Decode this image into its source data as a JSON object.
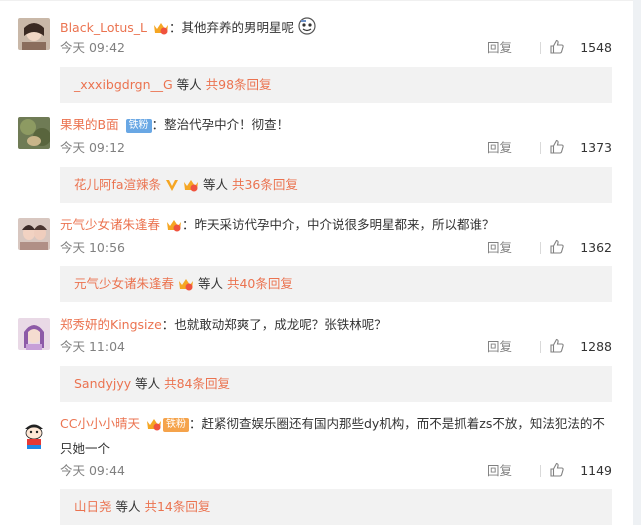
{
  "comments": [
    {
      "username": "Black_Lotus_L",
      "colon": "：",
      "text": "其他弃养的男明星呢",
      "time": "今天 09:42",
      "reply_label": "回复",
      "likes": "1548",
      "replies": {
        "names": "_xxxibgdrgn__G",
        "middle": " 等人 ",
        "total": "共98条回复"
      }
    },
    {
      "username": "果果的B面",
      "badge": "铁粉",
      "colon": "：",
      "text": "整治代孕中介！彻查！",
      "time": "今天 09:12",
      "reply_label": "回复",
      "likes": "1373",
      "replies": {
        "names": "花儿阿fa渲辣条",
        "middle": " 等人 ",
        "total": "共36条回复"
      }
    },
    {
      "username": "元气少女诸朱逢春",
      "colon": "：",
      "text": "昨天采访代孕中介，中介说很多明星都来，所以都谁？",
      "time": "今天 10:56",
      "reply_label": "回复",
      "likes": "1362",
      "replies": {
        "names": "元气少女诸朱逢春",
        "middle": " 等人 ",
        "total": "共40条回复"
      }
    },
    {
      "username": "郑秀妍的Kingsize",
      "colon": "：",
      "text": "也就敢动郑爽了，成龙呢？张铁林呢？",
      "time": "今天 11:04",
      "reply_label": "回复",
      "likes": "1288",
      "replies": {
        "names": "Sandyjyy",
        "middle": " 等人 ",
        "total": "共84条回复"
      }
    },
    {
      "username": "CC小小小晴天",
      "badge": "铁粉",
      "colon": "：",
      "text": "赶紧彻查娱乐圈还有国内那些dy机构，而不是抓着zs不放，知法犯法的不只她一个",
      "time": "今天 09:44",
      "reply_label": "回复",
      "likes": "1149",
      "replies": {
        "names": "山日尧",
        "middle": " 等人 ",
        "total": "共14条回复"
      }
    }
  ],
  "colors": {
    "username": "#eb7350",
    "text": "#333333",
    "meta": "#808080",
    "reply_bg": "#f2f2f2",
    "badge_blue": "#69a7e4"
  },
  "icons": [
    "crown-badge-icon",
    "like-thumb-icon",
    "emoji-sticker-icon",
    "v-verified-icon"
  ]
}
